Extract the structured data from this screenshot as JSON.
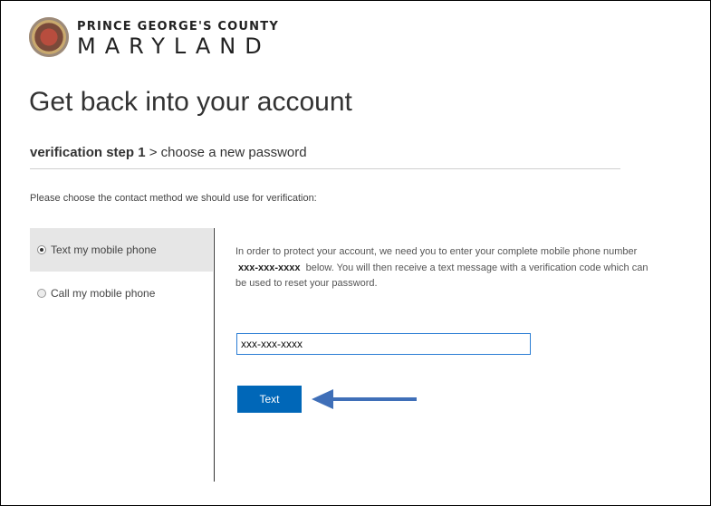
{
  "org": {
    "line1": "PRINCE GEORGE'S COUNTY",
    "line2": "MARYLAND",
    "seal_icon": "county-seal"
  },
  "page": {
    "title": "Get back into your account"
  },
  "steps": {
    "current": "verification step 1",
    "separator": ">",
    "next": "choose a new password"
  },
  "instructions": "Please choose the contact method we should use for verification:",
  "options": [
    {
      "label": "Text my mobile phone",
      "selected": true
    },
    {
      "label": "Call my mobile phone",
      "selected": false
    }
  ],
  "description": {
    "part1": "In order to protect your account, we need you to enter your complete mobile phone number",
    "masked_number": "xxx-xxx-xxxx",
    "part2": "below. You will then receive a text message with a verification code which can be used to reset your password."
  },
  "phone_input": {
    "value": "xxx-xxx-xxxx"
  },
  "submit_button": {
    "label": "Text"
  },
  "colors": {
    "accent": "#0067b8",
    "input_border": "#2b7dd4",
    "annotation_arrow": "#3f6fb8",
    "selected_option_bg": "#e6e6e6"
  },
  "annotation": {
    "icon": "left-arrow-icon"
  }
}
